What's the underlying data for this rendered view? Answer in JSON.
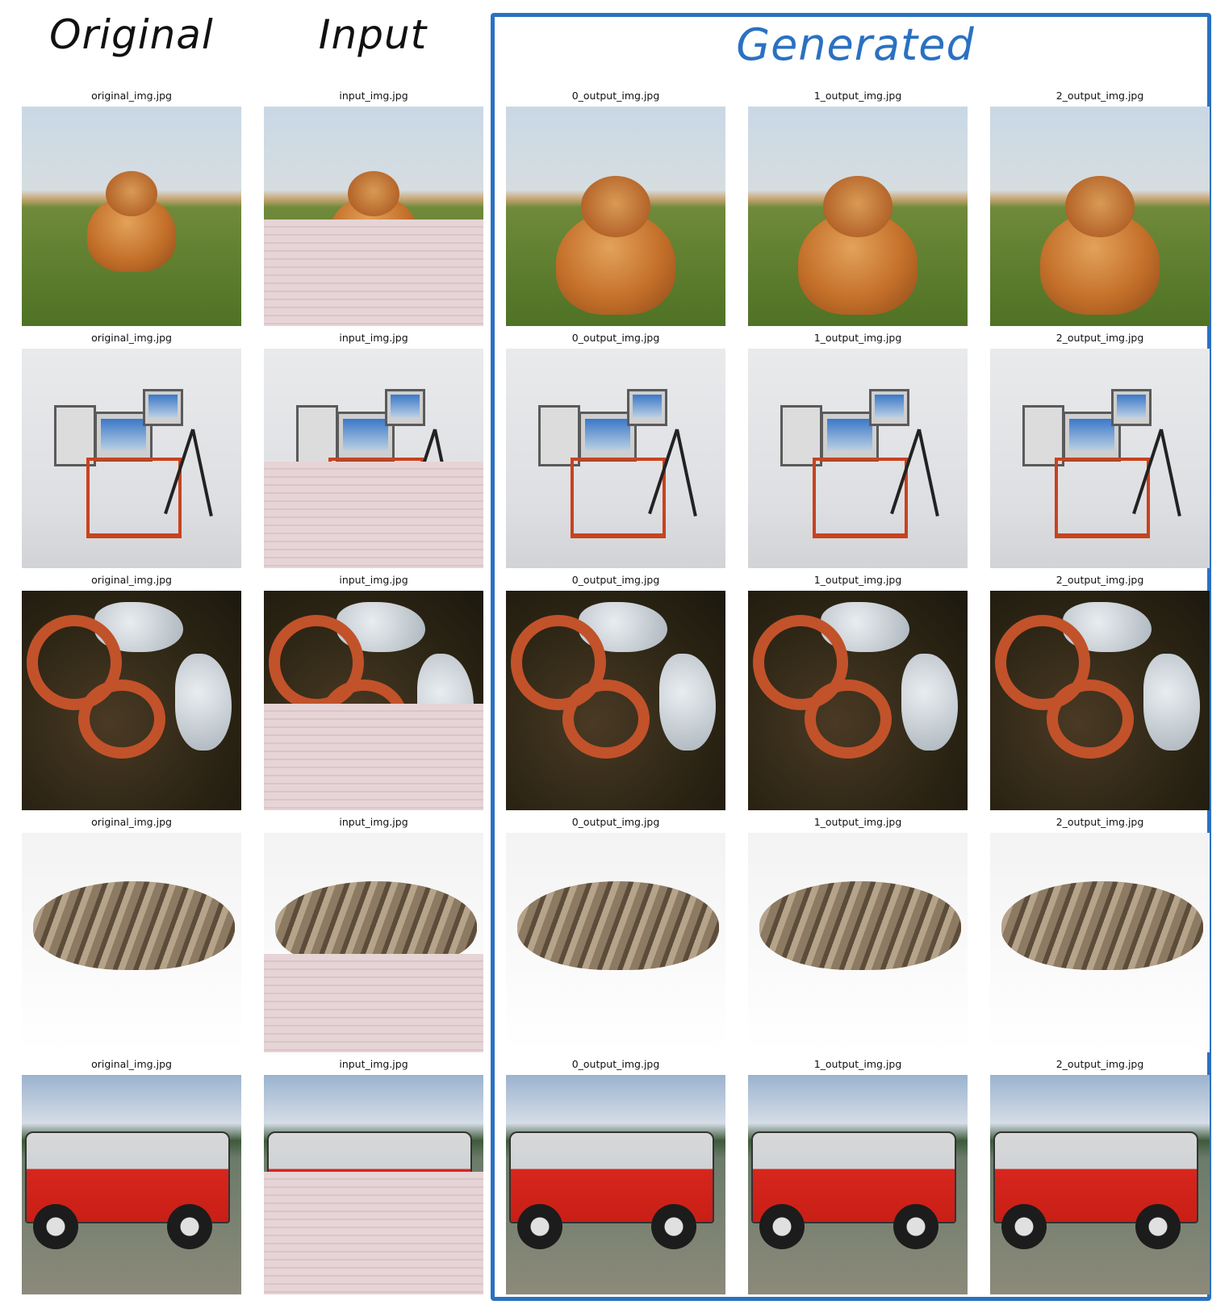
{
  "headers": {
    "original": "Original",
    "input": "Input",
    "generated": "Generated"
  },
  "rows": [
    {
      "subject": "dog",
      "captions": [
        "original_img.jpg",
        "input_img.jpg",
        "0_output_img.jpg",
        "1_output_img.jpg",
        "2_output_img.jpg"
      ]
    },
    {
      "subject": "lab-equipment",
      "captions": [
        "original_img.jpg",
        "input_img.jpg",
        "0_output_img.jpg",
        "1_output_img.jpg",
        "2_output_img.jpg"
      ]
    },
    {
      "subject": "worm",
      "captions": [
        "original_img.jpg",
        "input_img.jpg",
        "0_output_img.jpg",
        "1_output_img.jpg",
        "2_output_img.jpg"
      ]
    },
    {
      "subject": "cat",
      "captions": [
        "original_img.jpg",
        "input_img.jpg",
        "0_output_img.jpg",
        "1_output_img.jpg",
        "2_output_img.jpg"
      ]
    },
    {
      "subject": "truck",
      "captions": [
        "original_img.jpg",
        "input_img.jpg",
        "0_output_img.jpg",
        "1_output_img.jpg",
        "2_output_img.jpg"
      ]
    }
  ],
  "colors": {
    "generated_accent": "#2a71c2"
  }
}
